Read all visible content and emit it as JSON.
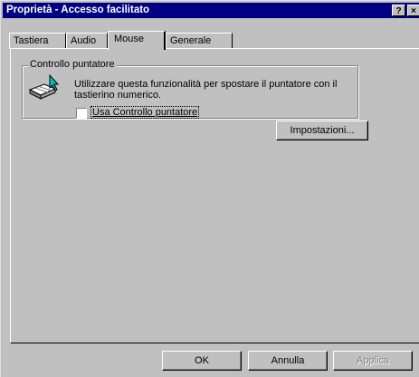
{
  "window": {
    "title": "Proprietà - Accesso facilitato",
    "help_button": "?",
    "close_button": "×"
  },
  "tabs": [
    {
      "label": "Tastiera"
    },
    {
      "label": "Audio"
    },
    {
      "label": "Mouse",
      "active": true
    },
    {
      "label": "Generale"
    }
  ],
  "group": {
    "title": "Controllo puntatore",
    "description": "Utilizzare questa funzionalità per spostare il puntatore con il tastierino numerico.",
    "checkbox_label": "Usa Controllo puntatore",
    "checkbox_checked": false,
    "settings_button": "Impostazioni...",
    "icon": "numeric-keypad-pointer-icon"
  },
  "footer": {
    "ok": "OK",
    "cancel": "Annulla",
    "apply": "Applica"
  },
  "colors": {
    "titlebar": "#000080",
    "face": "#c0c0c0"
  }
}
